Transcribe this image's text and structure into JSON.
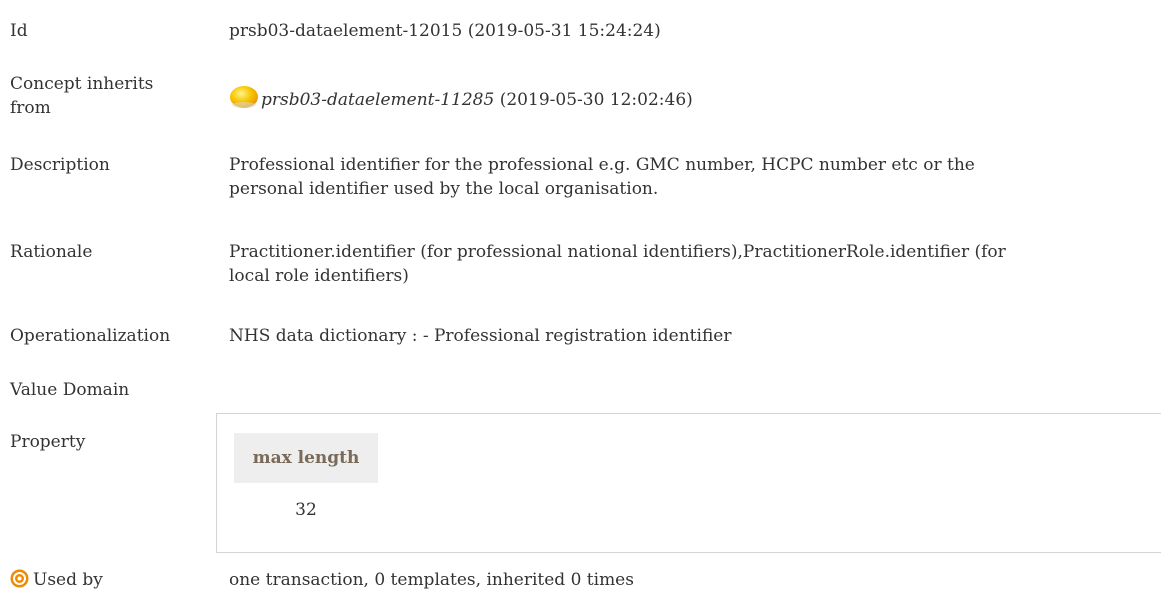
{
  "fields": {
    "id": {
      "label": "Id",
      "value": "prsb03-dataelement-12015 (2019-05-31 15:24:24)"
    },
    "inherits": {
      "label_line1": "Concept inherits",
      "label_line2": "from",
      "icon": "yellow-circle-icon",
      "ref_id": "prsb03-dataelement-11285",
      "ref_date": "(2019-05-30 12:02:46)"
    },
    "description": {
      "label": "Description",
      "line1": "Professional identifier for the professional e.g. GMC number, HCPC number etc or the",
      "line2": "personal identifier used by the local organisation."
    },
    "rationale": {
      "label": "Rationale",
      "line1": "Practitioner.identifier (for professional national identifiers),PractitionerRole.identifier (for",
      "line2": "local role identifiers)"
    },
    "operationalization": {
      "label": "Operationalization",
      "value": "NHS data dictionary : - Professional registration identifier"
    },
    "value_domain": {
      "label": "Value Domain"
    },
    "property": {
      "label": "Property",
      "header": "max length",
      "value": "32"
    },
    "used_by": {
      "icon": "target-icon",
      "label": "Used by",
      "value": "one transaction, 0 templates, inherited 0 times"
    }
  },
  "colors": {
    "text": "#333333",
    "header_text": "#7a6a5a",
    "header_bg": "#eeeeee",
    "icon_yellow": "#f5b800",
    "icon_orange": "#f08a00"
  }
}
